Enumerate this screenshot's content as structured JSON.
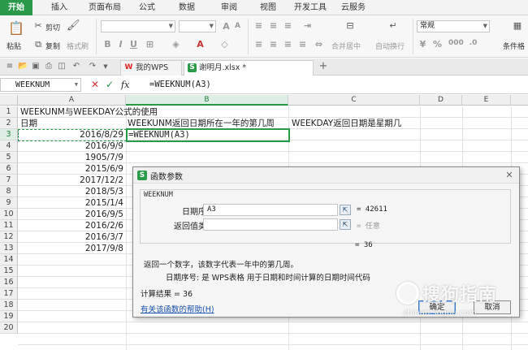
{
  "menu": {
    "tabs": [
      "开始",
      "插入",
      "页面布局",
      "公式",
      "数据",
      "审阅",
      "视图",
      "开发工具",
      "云服务"
    ]
  },
  "ribbon": {
    "paste": "粘贴",
    "cut": "剪切",
    "copy": "复制",
    "format_painter": "格式刷",
    "merge_center": "合并居中",
    "wrap_text": "自动换行",
    "number_format": "常规",
    "conditional_format": "条件格"
  },
  "tabs": {
    "wps": "我的WPS",
    "file": "谢明月.xlsx *"
  },
  "formula_bar": {
    "name_box": "WEEKNUM",
    "formula": "=WEEKNUM(A3)",
    "cancel_icon": "✕",
    "confirm_icon": "✓",
    "fx": "fx"
  },
  "sheet": {
    "columns": [
      "A",
      "B",
      "C",
      "D",
      "E"
    ],
    "rows": [
      "1",
      "2",
      "3",
      "4",
      "5",
      "6",
      "7",
      "8",
      "9",
      "10",
      "11",
      "12",
      "13",
      "14",
      "15",
      "16",
      "17",
      "18",
      "19",
      "20"
    ],
    "a1": "WEEKUNM与WEEKDAY公式的使用",
    "a2": "日期",
    "b2": "WEEKUNM返回日期所在一年的第几周",
    "c2": "WEEKDAY返回日期是星期几",
    "b3": "=WEEKNUM(A3)",
    "dates": [
      "2016/8/29",
      "2016/9/9",
      "1905/7/9",
      "2015/6/9",
      "2017/12/2",
      "2018/5/3",
      "2015/1/4",
      "2016/9/5",
      "2016/2/6",
      "2016/3/7",
      "2017/9/8"
    ]
  },
  "dialog": {
    "title": "函数参数",
    "function_name": "WEEKNUM",
    "param1_label": "日期序号",
    "param1_value": "A3",
    "param1_result": "= 42611",
    "param2_label": "返回值类型",
    "param2_value": "",
    "param2_result": "= 任意",
    "overall_result": "= 36",
    "description": "返回一个数字，该数字代表一年中的第几周。",
    "param_desc": "日期序号:   是 WPS表格 用于日期和时间计算的日期时间代码",
    "calc_result": "计算结果 = 36",
    "help_link": "有关该函数的帮助(H)",
    "ok": "确定",
    "cancel": "取消"
  },
  "watermark": {
    "main": "搜狗指南",
    "sub": "zhinan.sogou.com"
  },
  "colors": {
    "accent": "#2a9a4a",
    "dialog_bg": "#f5f5f5"
  }
}
